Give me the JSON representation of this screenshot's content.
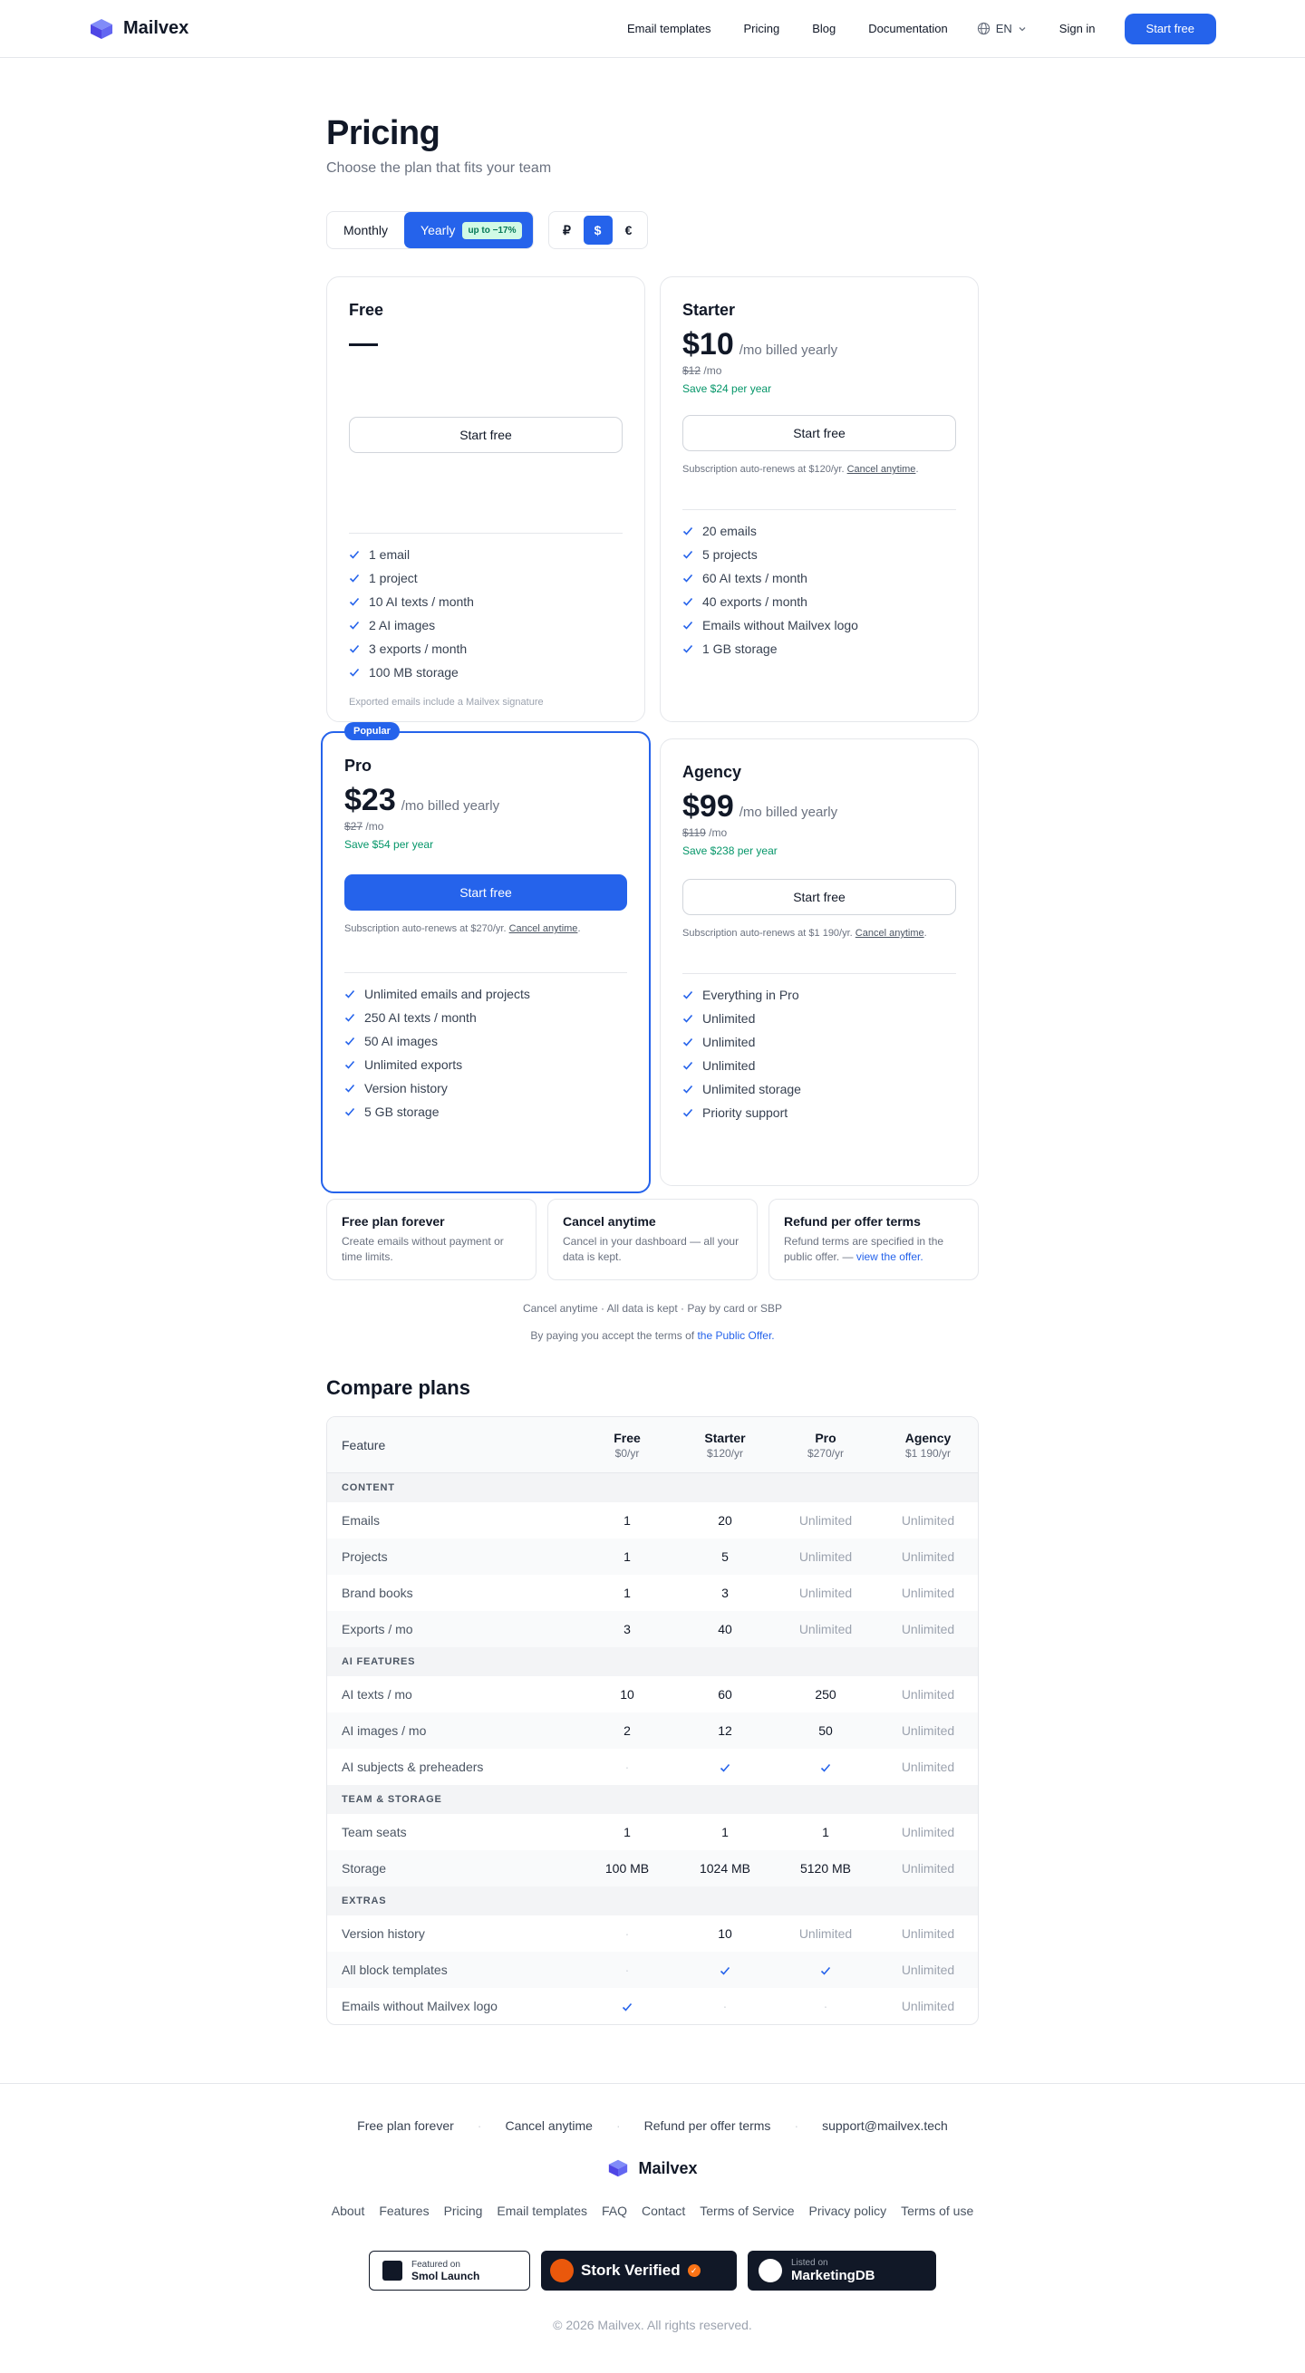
{
  "brand": {
    "name": "Mailvex",
    "accent": "#2563eb"
  },
  "nav": {
    "items": [
      "Email templates",
      "Pricing",
      "Blog",
      "Documentation"
    ],
    "lang": "EN",
    "signin": "Sign in",
    "cta": "Start free"
  },
  "hero": {
    "title": "Pricing",
    "subtitle": "Choose the plan that fits your team"
  },
  "billing": {
    "monthly": "Monthly",
    "yearly": "Yearly",
    "discount": "up to −17%",
    "selected": "Yearly"
  },
  "currency": {
    "options": [
      "₽",
      "$",
      "€"
    ],
    "selected": "$"
  },
  "plans": {
    "free": {
      "name": "Free",
      "cta": "Start free",
      "features": [
        "1 email",
        "1 project",
        "10 AI texts / month",
        "2 AI images",
        "3 exports / month",
        "100 MB storage"
      ],
      "note": "Exported emails include a Mailvex signature"
    },
    "starter": {
      "name": "Starter",
      "price": "$10",
      "period": "/mo billed yearly",
      "old_price": "$12",
      "old_suffix": "/mo",
      "save": "Save $24 per year",
      "cta": "Start free",
      "renew": "Subscription auto-renews at $120/yr.",
      "cancel": "Cancel anytime",
      "features": [
        "20 emails",
        "5 projects",
        "60 AI texts / month",
        "40 exports / month",
        "Emails without Mailvex logo",
        "1 GB storage"
      ]
    },
    "pro": {
      "badge": "Popular",
      "name": "Pro",
      "price": "$23",
      "period": "/mo billed yearly",
      "old_price": "$27",
      "old_suffix": "/mo",
      "save": "Save $54 per year",
      "cta": "Start free",
      "renew": "Subscription auto-renews at $270/yr.",
      "cancel": "Cancel anytime",
      "features": [
        "Unlimited emails and projects",
        "250 AI texts / month",
        "50 AI images",
        "Unlimited exports",
        "Version history",
        "5 GB storage"
      ]
    },
    "agency": {
      "name": "Agency",
      "price": "$99",
      "period": "/mo billed yearly",
      "old_price": "$119",
      "old_suffix": "/mo",
      "save": "Save $238 per year",
      "cta": "Start free",
      "renew": "Subscription auto-renews at $1 190/yr.",
      "cancel": "Cancel anytime",
      "features": [
        "Everything in Pro",
        "Unlimited",
        "Unlimited",
        "Unlimited",
        "Unlimited storage",
        "Priority support"
      ]
    }
  },
  "guarantees": [
    {
      "title": "Free plan forever",
      "desc": "Create emails without payment or time limits."
    },
    {
      "title": "Cancel anytime",
      "desc": "Cancel in your dashboard — all your data is kept."
    },
    {
      "title": "Refund per offer terms",
      "desc": "Refund terms are specified in the public offer. —",
      "link": "view the offer."
    }
  ],
  "notes": {
    "line1": "Cancel anytime · All data is kept · Pay by card or SBP",
    "line2_prefix": "By paying you accept the terms of",
    "line2_link": "the Public Offer."
  },
  "compare": {
    "title": "Compare plans",
    "feature_header": "Feature",
    "columns": [
      {
        "name": "Free",
        "price": "$0/yr"
      },
      {
        "name": "Starter",
        "price": "$120/yr"
      },
      {
        "name": "Pro",
        "price": "$270/yr"
      },
      {
        "name": "Agency",
        "price": "$1 190/yr"
      }
    ],
    "sections": [
      {
        "title": "CONTENT",
        "rows": [
          {
            "label": "Emails",
            "cells": [
              "1",
              "20",
              "Unlimited",
              "Unlimited"
            ]
          },
          {
            "label": "Projects",
            "cells": [
              "1",
              "5",
              "Unlimited",
              "Unlimited"
            ]
          },
          {
            "label": "Brand books",
            "cells": [
              "1",
              "3",
              "Unlimited",
              "Unlimited"
            ]
          },
          {
            "label": "Exports / mo",
            "cells": [
              "3",
              "40",
              "Unlimited",
              "Unlimited"
            ]
          }
        ]
      },
      {
        "title": "AI FEATURES",
        "rows": [
          {
            "label": "AI texts / mo",
            "cells": [
              "10",
              "60",
              "250",
              "Unlimited"
            ]
          },
          {
            "label": "AI images / mo",
            "cells": [
              "2",
              "12",
              "50",
              "Unlimited"
            ]
          },
          {
            "label": "AI subjects & preheaders",
            "cells": [
              "·",
              "✓",
              "✓",
              "Unlimited"
            ]
          }
        ]
      },
      {
        "title": "TEAM & STORAGE",
        "rows": [
          {
            "label": "Team seats",
            "cells": [
              "1",
              "1",
              "1",
              "Unlimited"
            ]
          },
          {
            "label": "Storage",
            "cells": [
              "100 MB",
              "1024 MB",
              "5120 MB",
              "Unlimited"
            ]
          }
        ]
      },
      {
        "title": "EXTRAS",
        "rows": [
          {
            "label": "Version history",
            "cells": [
              "·",
              "10",
              "Unlimited",
              "Unlimited"
            ]
          },
          {
            "label": "All block templates",
            "cells": [
              "·",
              "✓",
              "✓",
              "Unlimited"
            ]
          },
          {
            "label": "Emails without Mailvex logo",
            "cells": [
              "✓",
              "·",
              "·",
              "Unlimited"
            ]
          }
        ]
      }
    ]
  },
  "footer": {
    "top": [
      "Free plan forever",
      "Cancel anytime",
      "Refund per offer terms",
      "support@mailvex.tech"
    ],
    "sep": "·",
    "links": [
      "About",
      "Features",
      "Pricing",
      "Email templates",
      "FAQ",
      "Contact",
      "Terms of Service",
      "Privacy policy",
      "Terms of use"
    ],
    "badges": {
      "smol": {
        "small": "Featured on",
        "large": "Smol Launch"
      },
      "stork": {
        "large": "Stork Verified"
      },
      "mdb": {
        "small": "Listed on",
        "large": "MarketingDB"
      }
    },
    "copyright": "© 2026 Mailvex. All rights reserved."
  }
}
